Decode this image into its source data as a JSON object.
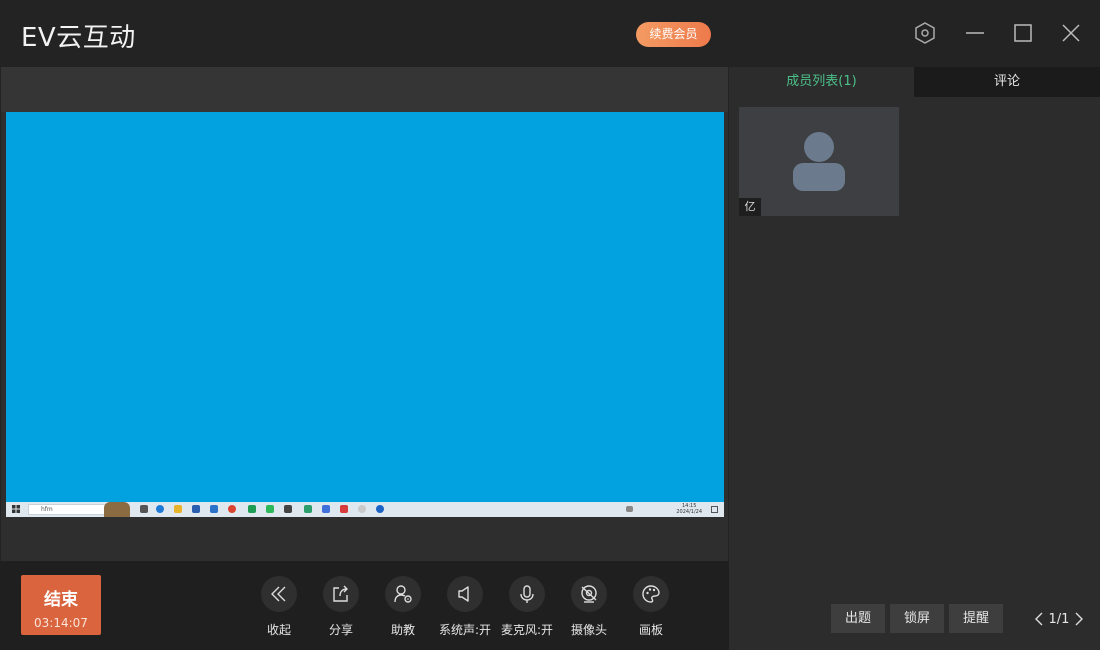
{
  "app": {
    "title": "EV云互动",
    "vip_label": "续费会员"
  },
  "window_controls": [
    "settings-icon",
    "minimize-icon",
    "maximize-icon",
    "close-icon"
  ],
  "end_button": {
    "label": "结束",
    "timer": "03:14:07"
  },
  "toolbar": [
    {
      "id": "collapse",
      "label": "收起",
      "icon": "double-chevron-left-icon"
    },
    {
      "id": "share",
      "label": "分享",
      "icon": "share-icon"
    },
    {
      "id": "assistant",
      "label": "助教",
      "icon": "assistant-icon"
    },
    {
      "id": "system-sound",
      "label": "系统声:开",
      "icon": "speaker-icon"
    },
    {
      "id": "microphone",
      "label": "麦克风:开",
      "icon": "microphone-icon"
    },
    {
      "id": "camera",
      "label": "摄像头",
      "icon": "camera-off-icon"
    },
    {
      "id": "whiteboard",
      "label": "画板",
      "icon": "palette-icon"
    }
  ],
  "side": {
    "tabs": {
      "members": "成员列表(1)",
      "comments": "评论"
    },
    "member": {
      "tag": "亿"
    },
    "buttons": {
      "quiz": "出题",
      "lock": "锁屏",
      "remind": "提醒"
    },
    "pager": "1/1"
  },
  "shared_screen": {
    "search_text": "hfm",
    "clock_time": "14:15",
    "clock_date": "2024/1/24"
  },
  "colors": {
    "accent_green": "#4cc08a",
    "end_red": "#d9643d",
    "screen_blue": "#02a2e0",
    "vip_orange": "#f08a56"
  }
}
